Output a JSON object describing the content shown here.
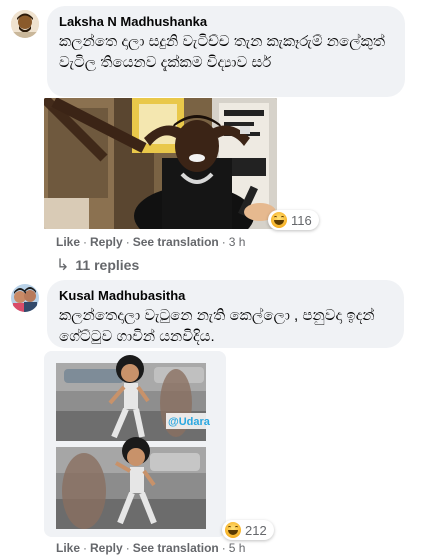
{
  "comments": [
    {
      "author": "Laksha N Madhushanka",
      "text": "කලන්තෙ දාලා සදුනි වැටිච්ච තැන කැකෑරුම් නලේකුත් වැටිල තියෙනව දැක්කම විද්‍යාව සර්",
      "reaction_count": "116",
      "reaction_icon": "haha-emoji-icon",
      "actions": {
        "like": "Like",
        "reply": "Reply",
        "see_translation": "See translation",
        "time": "3 h"
      },
      "replies_label": "11 replies"
    },
    {
      "author": "Kusal Madhubasitha",
      "text": "කලන්තෙදාලා වැටුනෙ නැති කෙල්ලො , පනුවදා ඉදන් ගේට්ටුව ගාවින් යනවිදිය.",
      "reaction_count": "212",
      "reaction_icon": "haha-emoji-icon",
      "watermark": "@Udara",
      "actions": {
        "like": "Like",
        "reply": "Reply",
        "see_translation": "See translation",
        "time": "5 h"
      }
    }
  ],
  "colors": {
    "bubble": "#f0f2f5",
    "secondary_text": "#65676b",
    "watermark": "#2aa7e0"
  }
}
